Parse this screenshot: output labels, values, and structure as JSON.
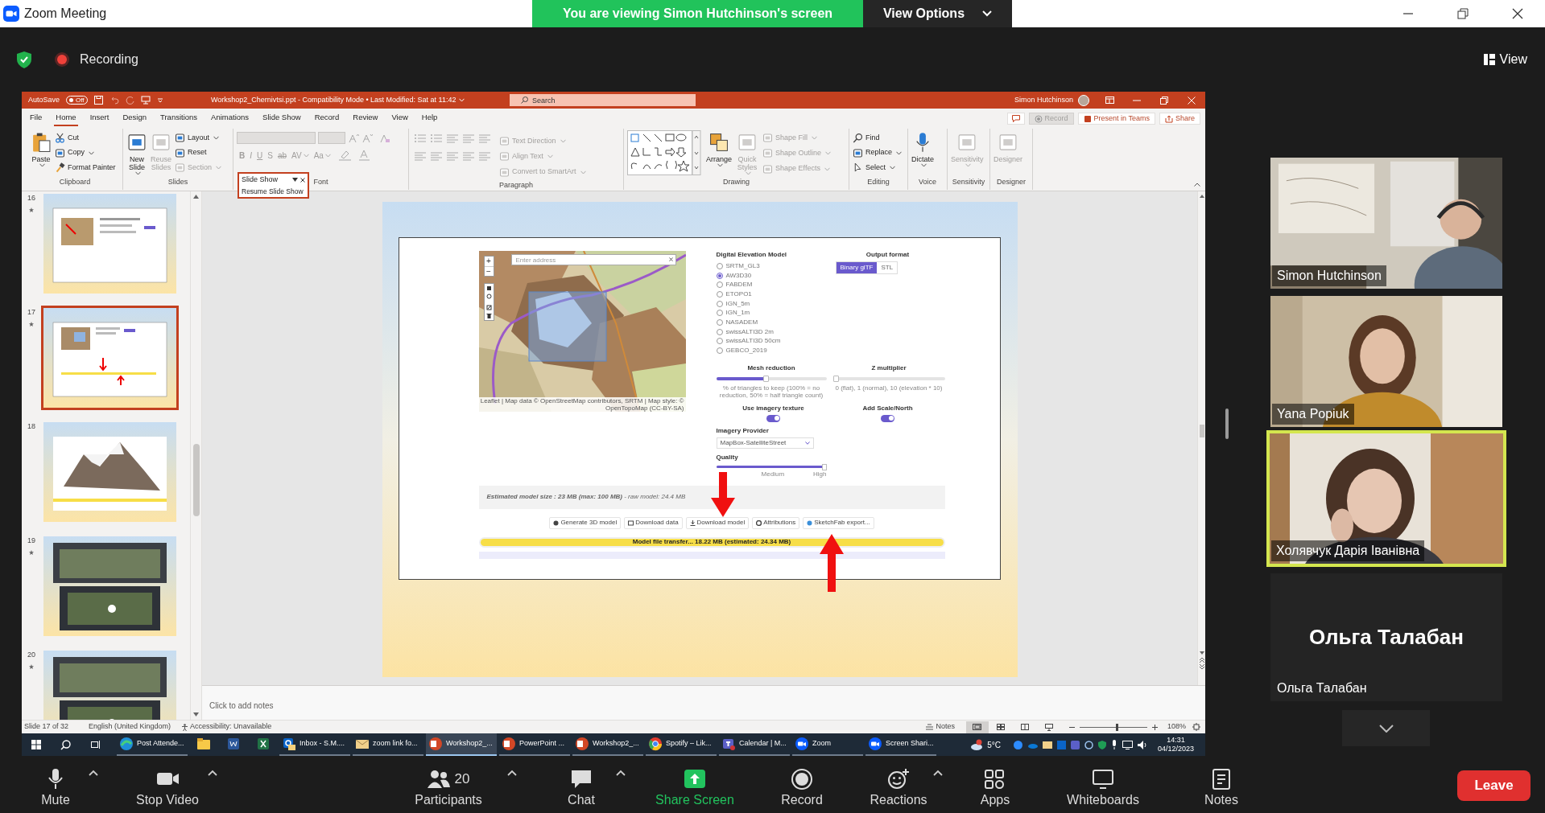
{
  "window": {
    "title": "Zoom Meeting"
  },
  "banner": {
    "text": "You are viewing Simon Hutchinson's screen",
    "button": "View Options"
  },
  "recording": {
    "label": "Recording"
  },
  "view_button": {
    "label": "View"
  },
  "powerpoint": {
    "autosave": {
      "label": "AutoSave",
      "switch": "Off",
      "on": false
    },
    "title": "Workshop2_Chernivtsi.ppt - Compatibility Mode • Last Modified: Sat at 11:42",
    "search": {
      "placeholder": "Search"
    },
    "user": "Simon Hutchinson",
    "tabs": [
      {
        "label": "File",
        "selected": false
      },
      {
        "label": "Home",
        "selected": true
      },
      {
        "label": "Insert",
        "selected": false
      },
      {
        "label": "Design",
        "selected": false
      },
      {
        "label": "Transitions",
        "selected": false
      },
      {
        "label": "Animations",
        "selected": false
      },
      {
        "label": "Slide Show",
        "selected": false
      },
      {
        "label": "Record",
        "selected": false
      },
      {
        "label": "Review",
        "selected": false
      },
      {
        "label": "View",
        "selected": false
      },
      {
        "label": "Help",
        "selected": false
      }
    ],
    "actions": [
      {
        "label": "Record",
        "disabled": true
      },
      {
        "label": "Present in Teams",
        "disabled": false
      },
      {
        "label": "Share",
        "disabled": false
      }
    ],
    "groups": [
      {
        "label": "Clipboard",
        "kind": "standard",
        "items": [
          {
            "kind": "large",
            "label": "Paste",
            "disabled": false,
            "dropdown": true
          },
          {
            "kind": "small",
            "label": "Cut",
            "disabled": false
          },
          {
            "kind": "small",
            "label": "Copy",
            "disabled": false,
            "dropdown": true
          },
          {
            "kind": "small",
            "label": "Format Painter",
            "disabled": false
          }
        ]
      },
      {
        "label": "Slides",
        "kind": "standard",
        "items": [
          {
            "kind": "large",
            "label": "New Slide",
            "disabled": false,
            "dropdown": true
          },
          {
            "kind": "large",
            "label": "Reuse Slides",
            "disabled": true
          },
          {
            "kind": "small",
            "label": "Layout",
            "disabled": false,
            "dropdown": true
          },
          {
            "kind": "small",
            "label": "Reset",
            "disabled": false
          },
          {
            "kind": "small",
            "label": "Section",
            "disabled": true,
            "dropdown": true
          }
        ]
      },
      {
        "label": "Font",
        "kind": "font",
        "items": [
          {
            "kind": "glyph",
            "label": "B",
            "disabled": true
          },
          {
            "kind": "glyph",
            "label": "I",
            "disabled": true
          },
          {
            "kind": "glyph",
            "label": "U",
            "disabled": true
          },
          {
            "kind": "glyph",
            "label": "S",
            "disabled": true
          },
          {
            "kind": "glyph",
            "label": "ab",
            "disabled": true
          },
          {
            "kind": "glyph",
            "label": "AV",
            "disabled": true,
            "dropdown": true
          },
          {
            "kind": "glyph",
            "label": "Aa",
            "disabled": true,
            "dropdown": true
          }
        ]
      },
      {
        "label": "Paragraph",
        "kind": "paragraph",
        "items": [
          {
            "kind": "small",
            "label": "Text Direction",
            "disabled": true,
            "dropdown": true
          },
          {
            "kind": "small",
            "label": "Align Text",
            "disabled": true,
            "dropdown": true
          },
          {
            "kind": "small",
            "label": "Convert to SmartArt",
            "disabled": true,
            "dropdown": true
          }
        ]
      },
      {
        "label": "Drawing",
        "kind": "drawing",
        "items": [
          {
            "kind": "large",
            "label": "Arrange",
            "disabled": false,
            "dropdown": true
          },
          {
            "kind": "large",
            "label": "Quick Styles",
            "disabled": true,
            "dropdown": true
          },
          {
            "kind": "small",
            "label": "Shape Fill",
            "disabled": true,
            "dropdown": true
          },
          {
            "kind": "small",
            "label": "Shape Outline",
            "disabled": true,
            "dropdown": true
          },
          {
            "kind": "small",
            "label": "Shape Effects",
            "disabled": true,
            "dropdown": true
          }
        ]
      },
      {
        "label": "Editing",
        "kind": "standard",
        "items": [
          {
            "kind": "small",
            "label": "Find",
            "disabled": false
          },
          {
            "kind": "small",
            "label": "Replace",
            "disabled": false,
            "dropdown": true
          },
          {
            "kind": "small",
            "label": "Select",
            "disabled": false,
            "dropdown": true
          }
        ]
      },
      {
        "label": "Voice",
        "kind": "standard",
        "items": [
          {
            "kind": "large",
            "label": "Dictate",
            "disabled": false,
            "dropdown": true
          }
        ]
      },
      {
        "label": "Sensitivity",
        "kind": "standard",
        "items": [
          {
            "kind": "large",
            "label": "Sensitivity",
            "disabled": true,
            "dropdown": true
          }
        ]
      },
      {
        "label": "Designer",
        "kind": "standard",
        "items": [
          {
            "kind": "large",
            "label": "Designer",
            "disabled": true
          }
        ]
      }
    ],
    "slideshow_toolbar": {
      "title": "Slide Show",
      "resume": "Resume Slide Show"
    },
    "thumbnails": [
      {
        "number": "16",
        "starred": true,
        "selected": false
      },
      {
        "number": "17",
        "starred": true,
        "selected": true
      },
      {
        "number": "18",
        "starred": false,
        "selected": false
      },
      {
        "number": "19",
        "starred": true,
        "selected": false
      },
      {
        "number": "20",
        "starred": true,
        "selected": false
      }
    ],
    "slide": {
      "address": {
        "placeholder": "Enter address"
      },
      "zoom_in": "+",
      "zoom_out": "−",
      "attribution": "Leaflet | Map data © OpenStreetMap contributors, SRTM | Map style: © OpenTopoMap (CC-BY-SA)",
      "dem": {
        "title": "Digital Elevation Model",
        "options": [
          {
            "label": "SRTM_GL3",
            "selected": false
          },
          {
            "label": "AW3D30",
            "selected": true
          },
          {
            "label": "FABDEM",
            "selected": false
          },
          {
            "label": "ETOPO1",
            "selected": false
          },
          {
            "label": "IGN_5m",
            "selected": false
          },
          {
            "label": "IGN_1m",
            "selected": false
          },
          {
            "label": "NASADEM",
            "selected": false
          },
          {
            "label": "swissALTI3D 2m",
            "selected": false
          },
          {
            "label": "swissALTI3D 50cm",
            "selected": false
          },
          {
            "label": "GEBCO_2019",
            "selected": false
          }
        ]
      },
      "output": {
        "title": "Output format",
        "options": [
          {
            "label": "Binary glTF",
            "selected": true
          },
          {
            "label": "STL",
            "selected": false
          }
        ]
      },
      "sliders": [
        {
          "title": "Mesh reduction",
          "level": 0.45,
          "hint": "% of triangles to keep (100% = no reduction, 50% = half triangle count)"
        },
        {
          "title": "Z multiplier",
          "level": 0,
          "hint": "0 (flat), 1 (normal), 10 (elevation * 10)"
        }
      ],
      "toggles": [
        {
          "label": "Use imagery texture",
          "on": true
        },
        {
          "label": "Add Scale/North",
          "on": true
        }
      ],
      "imagery": {
        "label": "Imagery Provider",
        "value": "MapBox-SatelliteStreet"
      },
      "quality": {
        "label": "Quality",
        "level": 1,
        "ticks": [
          "Medium",
          "High"
        ]
      },
      "estimate": "**Estimated model size : 23 MB (max: 100 MB)** - raw model: 24.4 MB",
      "buttons": [
        "Generate 3D model",
        "Download data",
        "Download model",
        "Attributions",
        "SketchFab export..."
      ],
      "progress": {
        "label": "Model file transfer... 18.22 MB (estimated: 24.34 MB)",
        "level": 1
      }
    },
    "notes_placeholder": "Click to add notes",
    "status_bar": {
      "slide": "Slide 17 of 32",
      "language": "English (United Kingdom)",
      "accessibility": "Accessibility: Unavailable",
      "notes": "Notes",
      "zoom": "108%",
      "zoom_slider": {
        "level": 0.55
      }
    }
  },
  "taskbar": {
    "apps": [
      {
        "kind": "window",
        "label": "Post Attende...",
        "selected": false
      },
      {
        "kind": "pinned",
        "selected": false
      },
      {
        "kind": "pinned",
        "selected": false
      },
      {
        "kind": "pinned",
        "selected": false
      },
      {
        "kind": "window",
        "label": "Inbox - S.M....",
        "selected": false
      },
      {
        "kind": "window",
        "label": "zoom link fo...",
        "selected": false
      },
      {
        "kind": "window",
        "label": "Workshop2_...",
        "selected": true
      },
      {
        "kind": "window",
        "label": "PowerPoint ...",
        "selected": false
      },
      {
        "kind": "window",
        "label": "Workshop2_...",
        "selected": false
      },
      {
        "kind": "window",
        "label": "Spotify – Lik...",
        "selected": false
      },
      {
        "kind": "window",
        "label": "Calendar | M...",
        "selected": false
      },
      {
        "kind": "window",
        "label": "Zoom",
        "selected": false
      },
      {
        "kind": "window",
        "label": "Screen Shari...",
        "selected": false
      }
    ],
    "weather": "5°C",
    "time": "14:31",
    "date": "04/12/2023"
  },
  "participants": [
    {
      "name": "Simon Hutchinson",
      "video": true,
      "speaking": false
    },
    {
      "name": "Yana Popiuk",
      "video": true,
      "speaking": false
    },
    {
      "name": "Холявчук Дарія Іванівна",
      "video": true,
      "speaking": true
    },
    {
      "name": "Ольга Талабан",
      "video": false,
      "speaking": false,
      "center_name": "Ольга Талабан"
    }
  ],
  "toolbar": [
    {
      "label": "Mute",
      "menu": true,
      "highlight": false
    },
    {
      "label": "Stop Video",
      "menu": true,
      "highlight": false
    },
    {
      "label": "Participants",
      "count": "20",
      "menu": true,
      "highlight": false
    },
    {
      "label": "Chat",
      "menu": true,
      "highlight": false
    },
    {
      "label": "Share Screen",
      "menu": false,
      "highlight": true
    },
    {
      "label": "Record",
      "menu": false,
      "highlight": false
    },
    {
      "label": "Reactions",
      "menu": true,
      "highlight": false
    },
    {
      "label": "Apps",
      "menu": false,
      "highlight": false
    },
    {
      "label": "Whiteboards",
      "menu": false,
      "highlight": false
    },
    {
      "label": "Notes",
      "menu": false,
      "highlight": false
    }
  ],
  "leave": "Leave"
}
